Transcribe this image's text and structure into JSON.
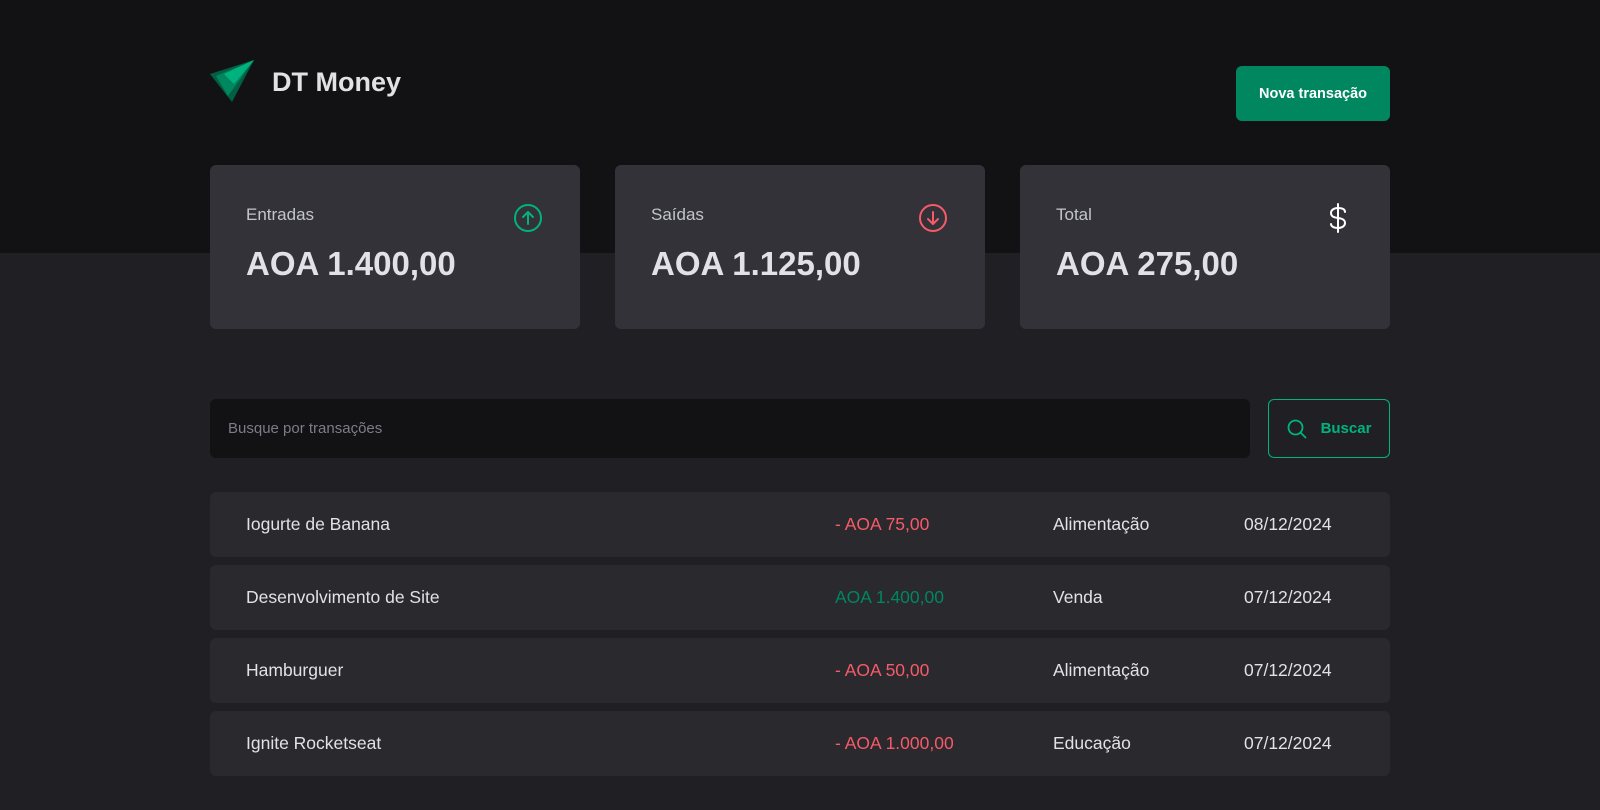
{
  "app": {
    "title": "DT Money",
    "logo_icon": "logo-icon"
  },
  "header": {
    "new_transaction_label": "Nova transação"
  },
  "summary": {
    "cards": [
      {
        "title": "Entradas",
        "value": "AOA 1.400,00",
        "icon": "arrow-circle-up-icon",
        "icon_color": "#00b37e"
      },
      {
        "title": "Saídas",
        "value": "AOA 1.125,00",
        "icon": "arrow-circle-down-icon",
        "icon_color": "#f75a68"
      },
      {
        "title": "Total",
        "value": "AOA 275,00",
        "icon": "currency-dollar-icon",
        "icon_color": "#ffffff"
      }
    ]
  },
  "search": {
    "placeholder": "Busque por transações",
    "button_label": "Buscar"
  },
  "transactions": [
    {
      "description": "Iogurte de Banana",
      "price": "- AOA 75,00",
      "type": "outcome",
      "category": "Alimentação",
      "date": "08/12/2024"
    },
    {
      "description": "Desenvolvimento de Site",
      "price": "AOA 1.400,00",
      "type": "income",
      "category": "Venda",
      "date": "07/12/2024"
    },
    {
      "description": "Hamburguer",
      "price": "- AOA 50,00",
      "type": "outcome",
      "category": "Alimentação",
      "date": "07/12/2024"
    },
    {
      "description": "Ignite Rocketseat",
      "price": "- AOA 1.000,00",
      "type": "outcome",
      "category": "Educação",
      "date": "07/12/2024"
    }
  ],
  "colors": {
    "brand": "#00875f",
    "brand_light": "#00b37e",
    "danger": "#f75a68",
    "background": "#202024",
    "header_background": "#121214"
  }
}
